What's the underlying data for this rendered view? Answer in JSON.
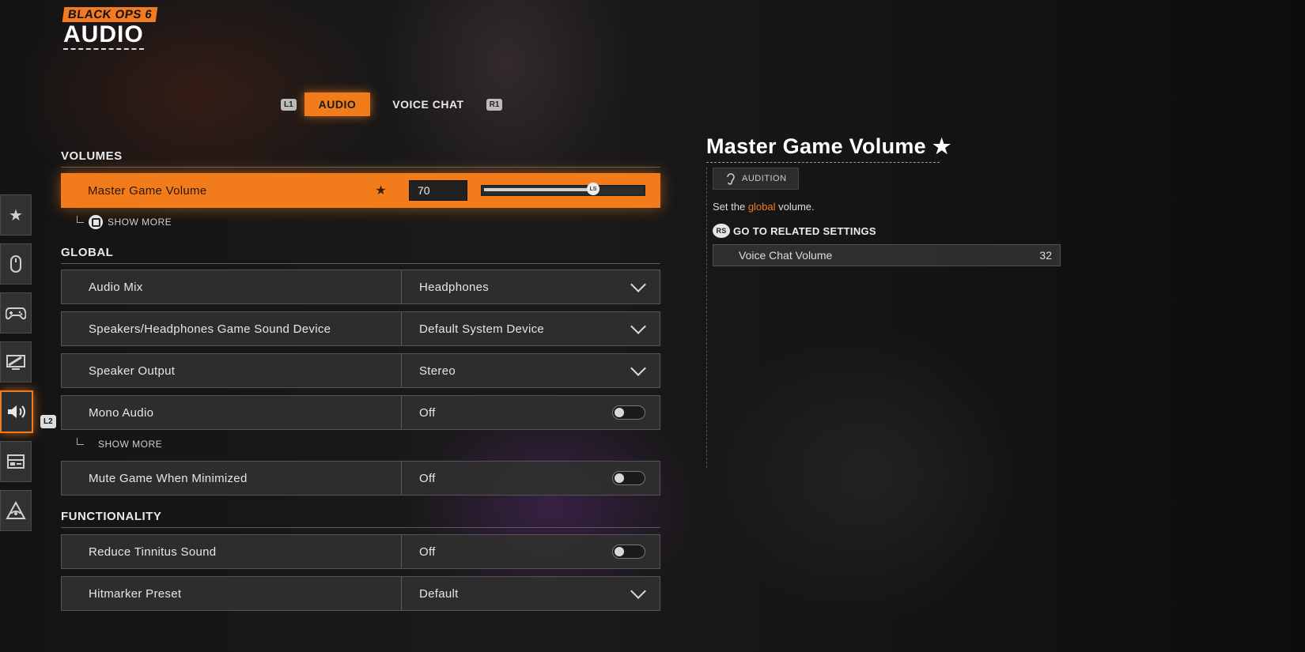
{
  "logo": {
    "game": "BLACK OPS 6",
    "page": "AUDIO"
  },
  "tabs": {
    "left_key": "L1",
    "right_key": "R1",
    "items": [
      "AUDIO",
      "VOICE CHAT"
    ],
    "active": "AUDIO"
  },
  "sidebar": {
    "items": [
      {
        "icon": "star-icon",
        "glyph": "★"
      },
      {
        "icon": "mouse-icon",
        "glyph": ""
      },
      {
        "icon": "controller-icon",
        "glyph": ""
      },
      {
        "icon": "display-icon",
        "glyph": ""
      },
      {
        "icon": "speaker-icon",
        "glyph": "",
        "active": true
      },
      {
        "icon": "interface-icon",
        "glyph": ""
      },
      {
        "icon": "network-icon",
        "glyph": ""
      }
    ],
    "active_key": "L2"
  },
  "sections": {
    "volumes": "VOLUMES",
    "global": "GLOBAL",
    "functionality": "FUNCTIONALITY"
  },
  "master_volume": {
    "label": "Master Game Volume",
    "value": "70",
    "percent": 70,
    "thumb": "LS"
  },
  "show_more_1": "SHOW MORE",
  "show_more_2": "SHOW MORE",
  "settings": {
    "audio_mix": {
      "label": "Audio Mix",
      "value": "Headphones"
    },
    "sound_device": {
      "label": "Speakers/Headphones Game Sound Device",
      "value": "Default System Device"
    },
    "speaker_output": {
      "label": "Speaker Output",
      "value": "Stereo"
    },
    "mono_audio": {
      "label": "Mono Audio",
      "value": "Off"
    },
    "mute_minimized": {
      "label": "Mute Game When Minimized",
      "value": "Off"
    },
    "tinnitus": {
      "label": "Reduce Tinnitus Sound",
      "value": "Off"
    },
    "hitmarker": {
      "label": "Hitmarker Preset",
      "value": "Default"
    }
  },
  "detail": {
    "title": "Master Game Volume",
    "audition": "AUDITION",
    "desc_pre": "Set the ",
    "desc_accent": "global",
    "desc_post": " volume.",
    "related_key": "RS",
    "related_title": "GO TO RELATED SETTINGS",
    "related_item": {
      "label": "Voice Chat Volume",
      "value": "32"
    }
  },
  "colors": {
    "accent": "#f27c1c"
  }
}
